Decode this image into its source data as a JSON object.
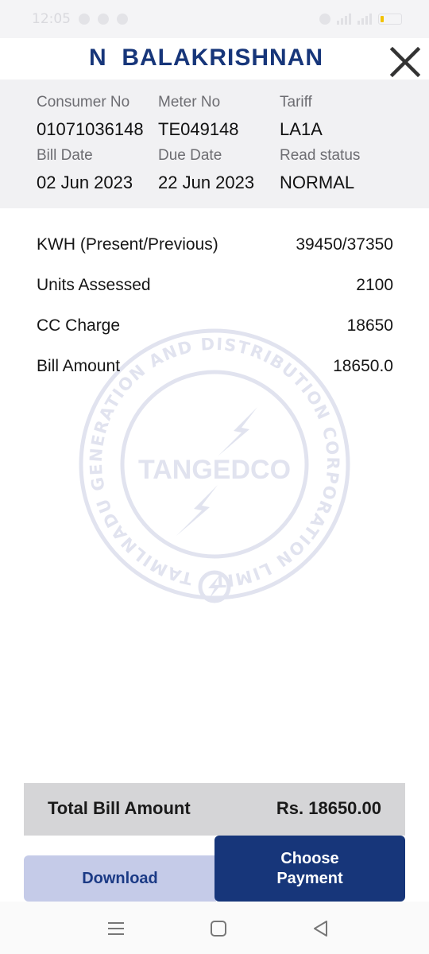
{
  "status_bar": {
    "time": "12:05",
    "accent_battery": "#f2c200"
  },
  "header": {
    "consumer_name": "N  BALAKRISHNAN",
    "close_icon": "close-icon",
    "title_color": "#17367a"
  },
  "info": {
    "consumer_no": {
      "label": "Consumer No",
      "value": "01071036148"
    },
    "meter_no": {
      "label": "Meter No",
      "value": "TE049148"
    },
    "tariff": {
      "label": "Tariff",
      "value": "LA1A"
    },
    "bill_date": {
      "label": "Bill Date",
      "value": "02 Jun 2023"
    },
    "due_date": {
      "label": "Due Date",
      "value": "22 Jun 2023"
    },
    "read_status": {
      "label": "Read status",
      "value": "NORMAL"
    }
  },
  "details": [
    {
      "label": "KWH (Present/Previous)",
      "value": "39450/37350"
    },
    {
      "label": "Units Assessed",
      "value": "2100"
    },
    {
      "label": "CC Charge",
      "value": "18650"
    },
    {
      "label": "Bill Amount",
      "value": "18650.0"
    }
  ],
  "watermark": {
    "center_text": "TANGEDCO",
    "ring_text": "TAMILNADU GENERATION AND DISTRIBUTION CORPORATION LIMITED",
    "color": "#c9cde2"
  },
  "total": {
    "label": "Total Bill Amount",
    "value": "Rs. 18650.00"
  },
  "actions": {
    "download_label": "Download",
    "payment_label": "Choose\nPayment",
    "primary_color": "#17367a",
    "secondary_color": "#c5cbe8"
  },
  "nav": {
    "menu_icon": "menu-icon",
    "home_icon": "home-icon",
    "back_icon": "back-icon"
  }
}
